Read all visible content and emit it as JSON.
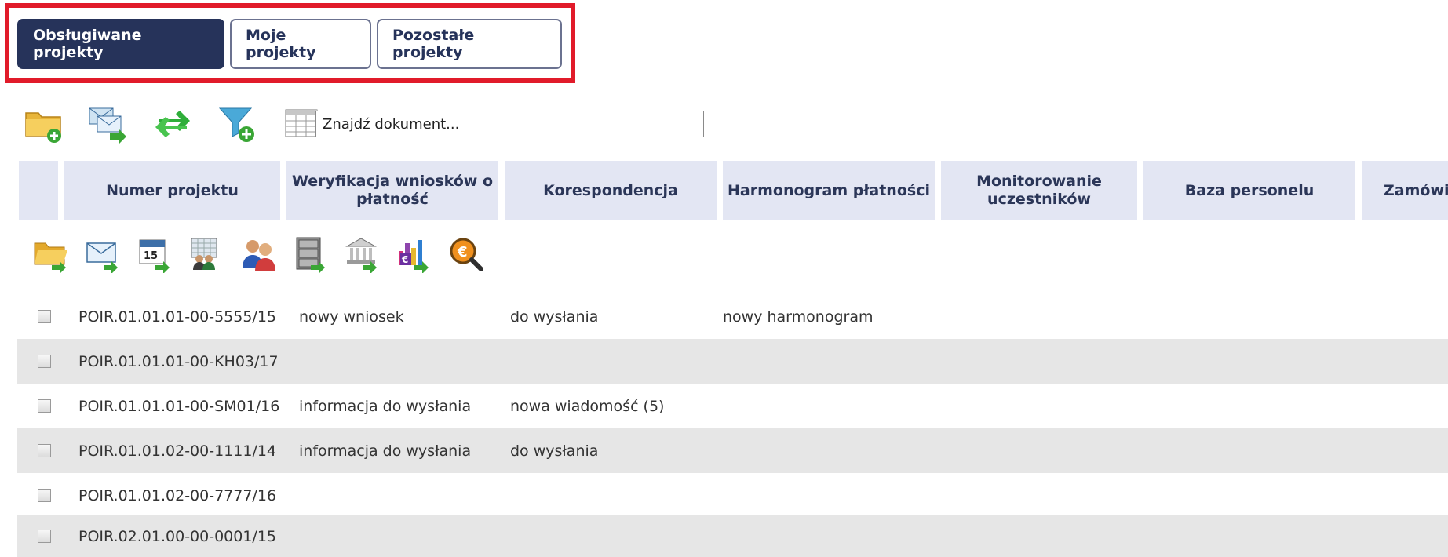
{
  "tabs": [
    {
      "label": "Obsługiwane projekty",
      "active": true
    },
    {
      "label": "Moje projekty",
      "active": false
    },
    {
      "label": "Pozostałe projekty",
      "active": false
    }
  ],
  "toolbar": {
    "icons": [
      "new-folder-icon",
      "mail-export-icon",
      "refresh-icon",
      "add-filter-icon",
      "table-columns-icon"
    ],
    "search_placeholder": "Znajdź dokument..."
  },
  "table": {
    "headers": [
      "",
      "Numer projektu",
      "Weryfikacja wniosków o płatność",
      "Korespondencja",
      "Harmonogram płatności",
      "Monitorowanie uczestników",
      "Baza personelu",
      "Zamówien"
    ],
    "action_icons": [
      "open-folder-icon",
      "mail-icon",
      "calendar-icon",
      "participants-icon",
      "personnel-icon",
      "cabinet-icon",
      "bank-icon",
      "funding-chart-icon",
      "euro-search-icon"
    ],
    "rows": [
      {
        "number": "POIR.01.01.01-00-5555/15",
        "weryfikacja": "nowy wniosek",
        "korespondencja": "do wysłania",
        "harmonogram": "nowy harmonogram"
      },
      {
        "number": "POIR.01.01.01-00-KH03/17",
        "weryfikacja": "",
        "korespondencja": "",
        "harmonogram": ""
      },
      {
        "number": "POIR.01.01.01-00-SM01/16",
        "weryfikacja": "informacja do wysłania",
        "korespondencja": "nowa wiadomość (5)",
        "harmonogram": ""
      },
      {
        "number": "POIR.01.01.02-00-1111/14",
        "weryfikacja": "informacja do wysłania",
        "korespondencja": "do wysłania",
        "harmonogram": ""
      },
      {
        "number": "POIR.01.01.02-00-7777/16",
        "weryfikacja": "",
        "korespondencja": "",
        "harmonogram": ""
      },
      {
        "number": "POIR.02.01.00-00-0001/15",
        "weryfikacja": "",
        "korespondencja": "",
        "harmonogram": ""
      }
    ]
  },
  "colors": {
    "accent": "#26335a",
    "highlight": "#e11b2a",
    "header_bg": "#e3e6f3",
    "row_alt": "#e6e6e6"
  }
}
